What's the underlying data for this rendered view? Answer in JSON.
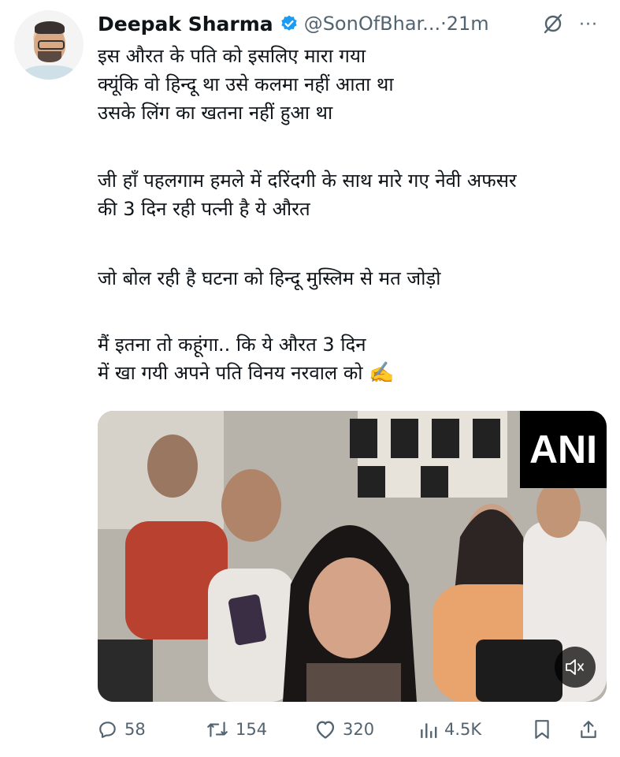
{
  "tweet": {
    "author_name": "Deepak Sharma",
    "handle": "@SonOfBhar...",
    "separator": "·",
    "time": "21m",
    "more": "···",
    "lines": [
      "इस औरत के पति को इसलिए मारा गया",
      "क्यूंकि वो हिन्दू था उसे कलमा नहीं आता था",
      "उसके लिंग का खतना नहीं हुआ था",
      "जी हाँ पहलगाम हमले में दरिंदगी के साथ मारे गए नेवी अफसर",
      "की 3 दिन रही पत्नी है ये औरत",
      "जो बोल रही है घटना को हिन्दू मुस्लिम से मत जोड़ो",
      "मैं इतना तो कहूंगा.. कि ये औरत 3 दिन",
      "में खा गयी अपने पति विनय नरवाल को"
    ],
    "emoji": "✍️"
  },
  "media": {
    "badge": "ANI",
    "mic_label": "ANI",
    "mute_symbol": "🔇"
  },
  "actions": {
    "replies": "58",
    "retweets": "154",
    "likes": "320",
    "views": "4.5K"
  },
  "colors": {
    "verified": "#1d9bf0",
    "secondary_text": "#536471",
    "primary_text": "#0f1419"
  }
}
